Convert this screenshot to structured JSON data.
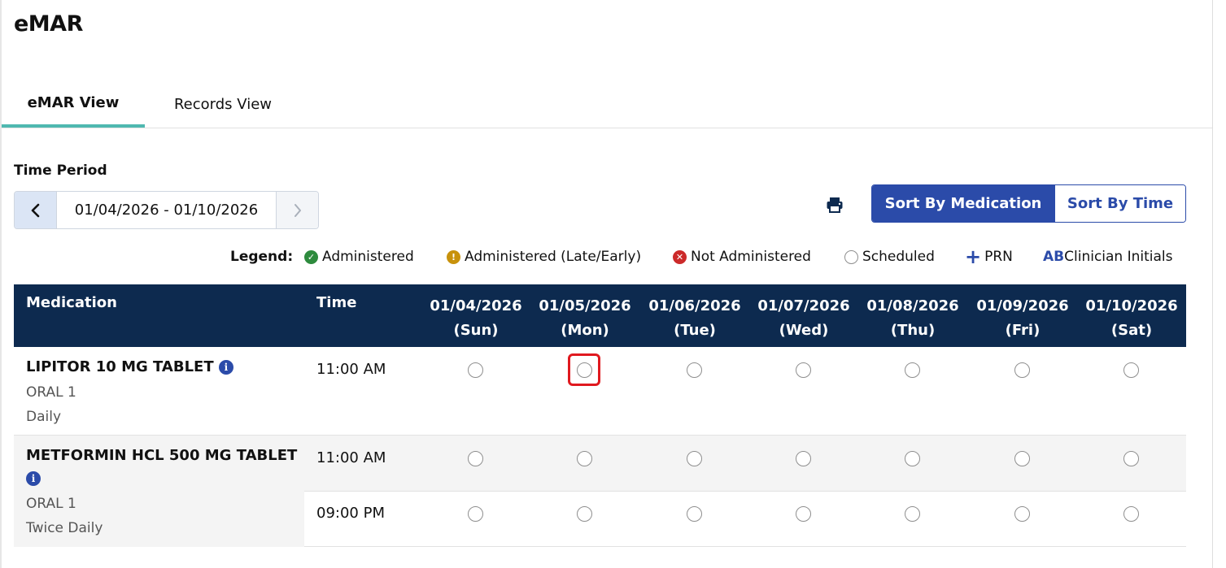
{
  "page": {
    "title": "eMAR"
  },
  "tabs": [
    {
      "label": "eMAR View",
      "active": true
    },
    {
      "label": "Records View",
      "active": false
    }
  ],
  "time_period": {
    "label": "Time Period",
    "range": "01/04/2026 - 01/10/2026"
  },
  "sort": {
    "by_medication": "Sort By Medication",
    "by_time": "Sort By Time",
    "active": "by_medication"
  },
  "legend": {
    "title": "Legend:",
    "administered": "Administered",
    "late_early": "Administered (Late/Early)",
    "not_administered": "Not Administered",
    "scheduled": "Scheduled",
    "prn": "PRN",
    "initials_abbrev": "AB",
    "initials": "Clinician Initials"
  },
  "table": {
    "headers": {
      "medication": "Medication",
      "time": "Time",
      "dates": [
        {
          "date": "01/04/2026",
          "day": "(Sun)"
        },
        {
          "date": "01/05/2026",
          "day": "(Mon)"
        },
        {
          "date": "01/06/2026",
          "day": "(Tue)"
        },
        {
          "date": "01/07/2026",
          "day": "(Wed)"
        },
        {
          "date": "01/08/2026",
          "day": "(Thu)"
        },
        {
          "date": "01/09/2026",
          "day": "(Fri)"
        },
        {
          "date": "01/10/2026",
          "day": "(Sat)"
        }
      ]
    },
    "rows": [
      {
        "name": "LIPITOR 10 MG TABLET",
        "route": "ORAL 1",
        "frequency": "Daily",
        "times": [
          {
            "time": "11:00 AM",
            "statuses": [
              "scheduled",
              "scheduled",
              "scheduled",
              "scheduled",
              "scheduled",
              "scheduled",
              "scheduled"
            ]
          }
        ]
      },
      {
        "name": "METFORMIN HCL 500 MG TABLET",
        "route": "ORAL 1",
        "frequency": "Twice Daily",
        "times": [
          {
            "time": "11:00 AM",
            "statuses": [
              "scheduled",
              "scheduled",
              "scheduled",
              "scheduled",
              "scheduled",
              "scheduled",
              "scheduled"
            ]
          },
          {
            "time": "09:00 PM",
            "statuses": [
              "scheduled",
              "scheduled",
              "scheduled",
              "scheduled",
              "scheduled",
              "scheduled",
              "scheduled"
            ]
          }
        ]
      }
    ]
  },
  "colors": {
    "header_bg": "#0d2a4f",
    "accent_blue": "#2b4ba9",
    "tab_underline": "#4fb8b0",
    "highlight": "#e0191f"
  }
}
